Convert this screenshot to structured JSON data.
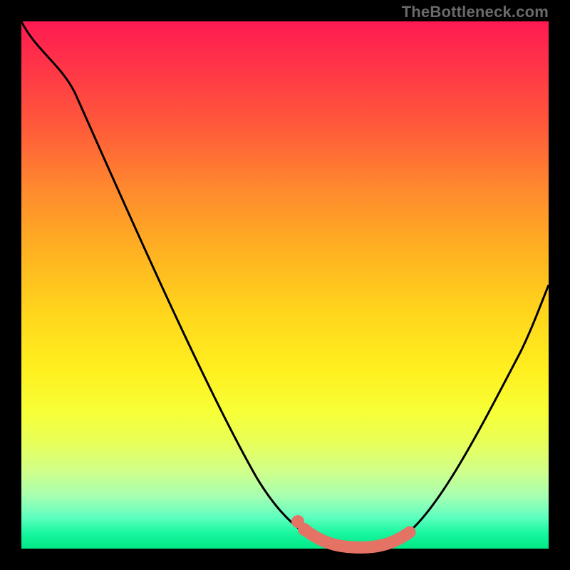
{
  "attribution": "TheBottleneck.com",
  "colors": {
    "background": "#000000",
    "gradient_top": "#ff1a52",
    "gradient_mid": "#ffe01f",
    "gradient_bottom": "#00e886",
    "curve": "#000000",
    "marker": "#e47265"
  },
  "chart_data": {
    "type": "line",
    "title": "",
    "xlabel": "",
    "ylabel": "",
    "xlim": [
      0,
      100
    ],
    "ylim": [
      0,
      100
    ],
    "series": [
      {
        "name": "bottleneck-curve",
        "x": [
          0,
          5,
          10,
          15,
          20,
          25,
          30,
          35,
          40,
          45,
          50,
          53,
          56,
          59,
          62,
          65,
          68,
          71,
          74,
          78,
          82,
          86,
          90,
          95,
          100
        ],
        "y": [
          100,
          93,
          86,
          78,
          70,
          62,
          53,
          44,
          35,
          26,
          17,
          11,
          6,
          3,
          1,
          0,
          0,
          1,
          3,
          8,
          15,
          23,
          31,
          40,
          50
        ]
      }
    ],
    "markers": {
      "name": "highlighted-range",
      "x": [
        53,
        56,
        59,
        62,
        65,
        68,
        71,
        74
      ],
      "y": [
        11,
        6,
        3,
        1,
        0,
        0,
        1,
        3
      ]
    },
    "annotations": []
  }
}
